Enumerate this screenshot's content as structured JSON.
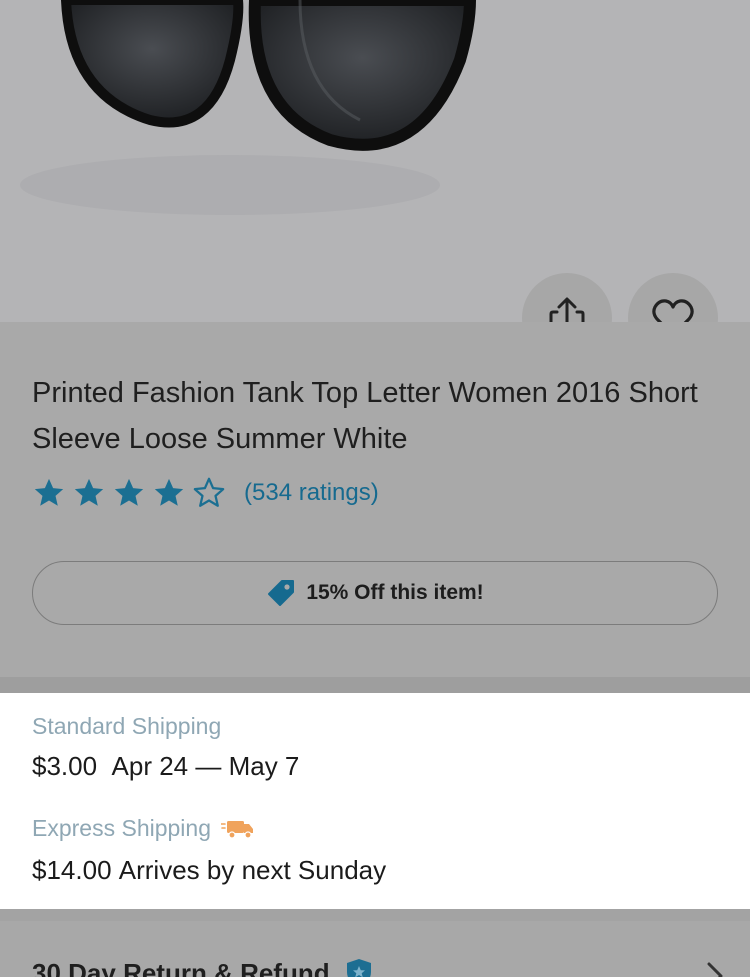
{
  "product": {
    "title": "Printed Fashion Tank Top Letter Women 2016 Short Sleeve Loose Summer White",
    "rating_value": 4,
    "rating_max": 5,
    "ratings_text": "(534 ratings)",
    "promo_text": "15% Off this item!"
  },
  "actions": {
    "share_icon": "share-icon",
    "favorite_icon": "heart-icon"
  },
  "shipping": {
    "standard_label": "Standard Shipping",
    "standard_price": "$3.00",
    "standard_dates": "Apr 24 — May 7",
    "express_label": "Express Shipping",
    "express_icon": "truck-icon",
    "express_price": "$14.00",
    "express_arrival": "Arrives by next Sunday"
  },
  "returns": {
    "title": "30 Day Return & Refund",
    "badge_icon": "shield-icon"
  },
  "colors": {
    "accent_blue": "#166a8f",
    "star_blue": "#1b6f92",
    "truck_orange": "#f0a35c",
    "shipping_label": "#8fa7b4"
  }
}
